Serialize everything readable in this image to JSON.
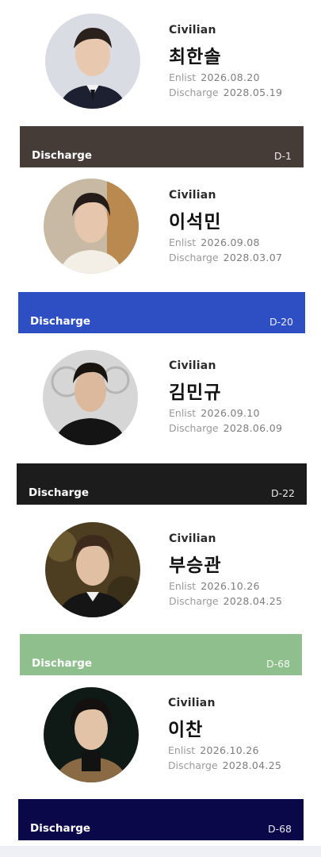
{
  "members": [
    {
      "status": "Civilian",
      "name": "최한솔",
      "enlist_label": "Enlist",
      "enlist_date": "2026.08.20",
      "discharge_label": "Discharge",
      "discharge_date": "2028.05.19",
      "bar_label": "Discharge",
      "dday": "D-1",
      "bar_color": "#453b37"
    },
    {
      "status": "Civilian",
      "name": "이석민",
      "enlist_label": "Enlist",
      "enlist_date": "2026.09.08",
      "discharge_label": "Discharge",
      "discharge_date": "2028.03.07",
      "bar_label": "Discharge",
      "dday": "D-20",
      "bar_color": "#2e4fc4"
    },
    {
      "status": "Civilian",
      "name": "김민규",
      "enlist_label": "Enlist",
      "enlist_date": "2026.09.10",
      "discharge_label": "Discharge",
      "discharge_date": "2028.06.09",
      "bar_label": "Discharge",
      "dday": "D-22",
      "bar_color": "#1c1c1c"
    },
    {
      "status": "Civilian",
      "name": "부승관",
      "enlist_label": "Enlist",
      "enlist_date": "2026.10.26",
      "discharge_label": "Discharge",
      "discharge_date": "2028.04.25",
      "bar_label": "Discharge",
      "dday": "D-68",
      "bar_color": "#8fbf8c"
    },
    {
      "status": "Civilian",
      "name": "이찬",
      "enlist_label": "Enlist",
      "enlist_date": "2026.10.26",
      "discharge_label": "Discharge",
      "discharge_date": "2028.04.25",
      "bar_label": "Discharge",
      "dday": "D-68",
      "bar_color": "#0a0848"
    }
  ]
}
